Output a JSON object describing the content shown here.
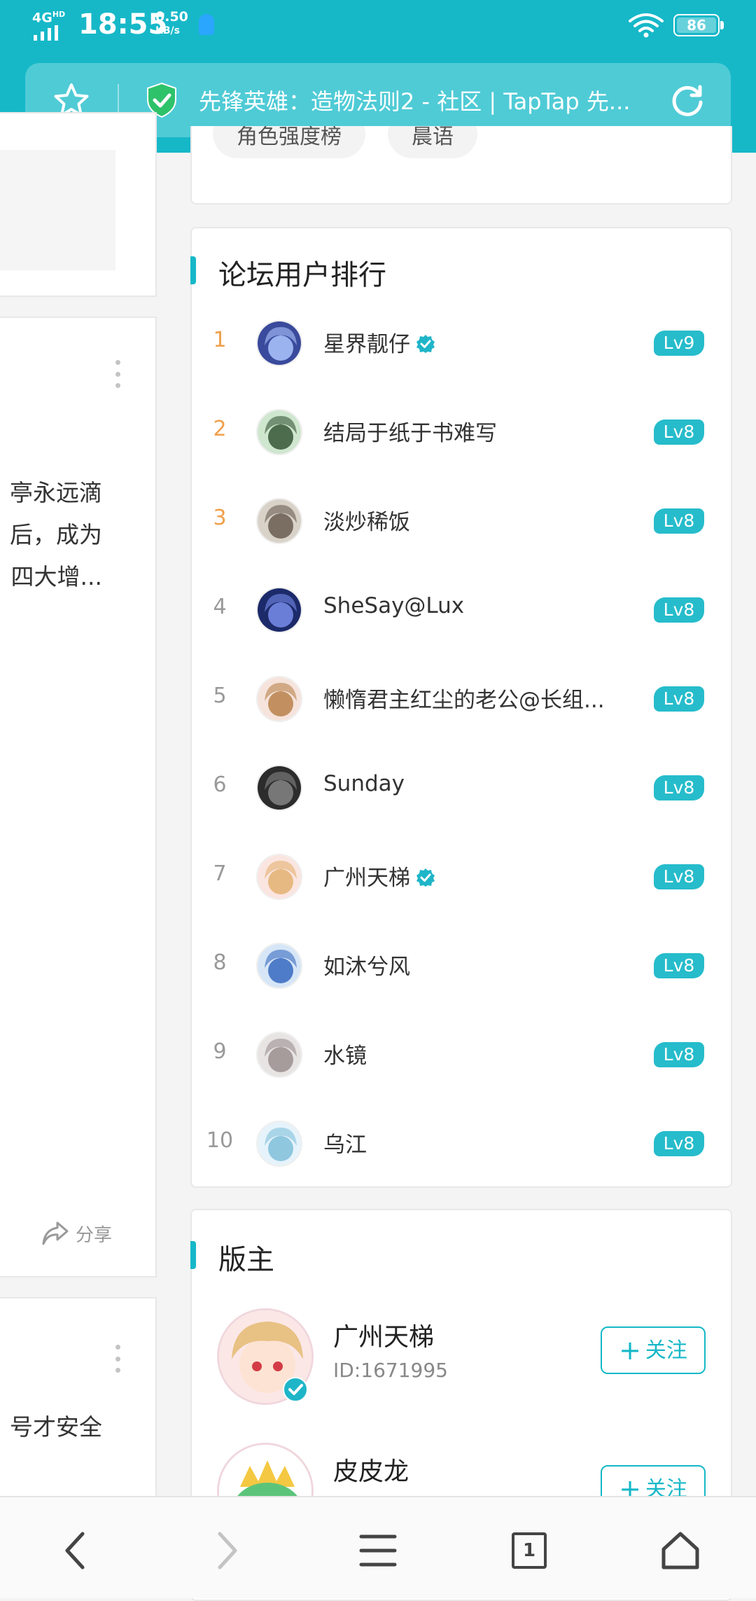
{
  "status_bar": {
    "network": "4G",
    "network_sup": "HD",
    "time": "18:55",
    "speed_value": "0.50",
    "speed_unit": "KB/s",
    "battery": "86"
  },
  "address_bar": {
    "title": "先锋英雄：造物法则2 - 社区 | TapTap 先..."
  },
  "left_column": {
    "post1_lines": [
      "亭永远滴",
      "后，成为",
      "。四大增..."
    ],
    "share_label": "分享",
    "post2_lines": [
      "号才安全"
    ]
  },
  "top_card": {
    "chips": [
      "角色强度榜",
      "晨语"
    ]
  },
  "ranking": {
    "title": "论坛用户排行",
    "users": [
      {
        "rank": "1",
        "name": "星界靓仔",
        "verified": true,
        "level": "Lv9"
      },
      {
        "rank": "2",
        "name": "结局于纸于书难写",
        "verified": false,
        "level": "Lv8"
      },
      {
        "rank": "3",
        "name": "淡炒稀饭",
        "verified": false,
        "level": "Lv8"
      },
      {
        "rank": "4",
        "name": "SheSay@Lux",
        "verified": false,
        "level": "Lv8"
      },
      {
        "rank": "5",
        "name": "懒惰君主红尘的老公@长组...",
        "verified": false,
        "level": "Lv8"
      },
      {
        "rank": "6",
        "name": "Sunday",
        "verified": false,
        "level": "Lv8"
      },
      {
        "rank": "7",
        "name": "广州天梯",
        "verified": true,
        "level": "Lv8"
      },
      {
        "rank": "8",
        "name": "如沐兮风",
        "verified": false,
        "level": "Lv8"
      },
      {
        "rank": "9",
        "name": "水镜",
        "verified": false,
        "level": "Lv8"
      },
      {
        "rank": "10",
        "name": "乌江",
        "verified": false,
        "level": "Lv8"
      }
    ]
  },
  "moderators": {
    "title": "版主",
    "list": [
      {
        "name": "广州天梯",
        "id": "ID:1671995",
        "follow": "关注"
      },
      {
        "name": "皮皮龙",
        "id": "",
        "follow": "关注"
      }
    ]
  },
  "bottom_nav": {
    "tab_count": "1"
  },
  "colors": {
    "accent": "#16b8c8",
    "rank_top": "#f0a04b",
    "level_badge": "#26bccb"
  }
}
